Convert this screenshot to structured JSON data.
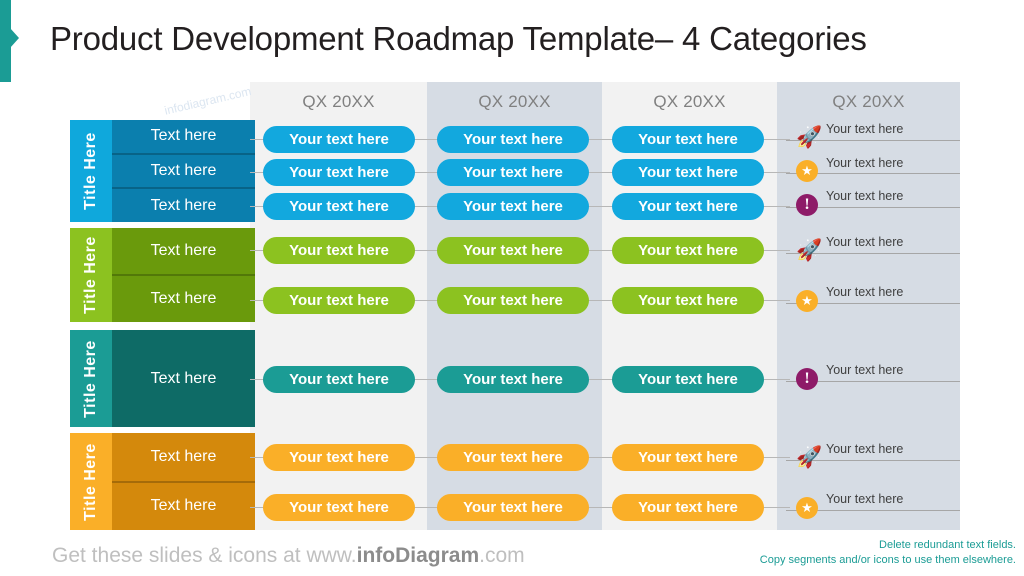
{
  "title": "Product Development Roadmap Template– 4 Categories",
  "columns": [
    {
      "label": "QX 20XX",
      "shade": "light"
    },
    {
      "label": "QX 20XX",
      "shade": "dark"
    },
    {
      "label": "QX 20XX",
      "shade": "light"
    },
    {
      "label": "QX 20XX",
      "shade": "dark"
    }
  ],
  "watermark": "infodiagram.com",
  "pill_label": "Your text here",
  "row_label": "Text here",
  "categories": [
    {
      "title": "Title Here",
      "title_color": "#0FA8DC",
      "panel_color": "#0B7FAE",
      "pill_color": "#12A8DE",
      "rows": [
        "Text here",
        "Text here",
        "Text here"
      ]
    },
    {
      "title": "Title Here",
      "title_color": "#8CC220",
      "panel_color": "#6A9A0C",
      "pill_color": "#8CC220",
      "rows": [
        "Text here",
        "Text here"
      ]
    },
    {
      "title": "Title Here",
      "title_color": "#1B9C95",
      "panel_color": "#0E6B66",
      "pill_color": "#1B9C95",
      "rows": [
        "Text here"
      ]
    },
    {
      "title": "Title Here",
      "title_color": "#FAAF28",
      "panel_color": "#D4890C",
      "pill_color": "#FAAF28",
      "rows": [
        "Text here",
        "Text here"
      ]
    }
  ],
  "right_column": {
    "items": [
      {
        "text": "Your text here",
        "icon": "rocket-icon",
        "icon_color": "#0B7FAE"
      },
      {
        "text": "Your text here",
        "icon": "star-badge-icon",
        "icon_color": "#FAAF28"
      },
      {
        "text": "Your text here",
        "icon": "exclamation-badge-icon",
        "icon_color": "#8E1B68"
      },
      {
        "text": "Your text here",
        "icon": "rocket-icon",
        "icon_color": "#6A9A0C"
      },
      {
        "text": "Your text here",
        "icon": "star-badge-icon",
        "icon_color": "#FAAF28"
      },
      {
        "text": "Your text here",
        "icon": "exclamation-badge-icon",
        "icon_color": "#8E1B68"
      },
      {
        "text": "Your text here",
        "icon": "rocket-icon",
        "icon_color": "#D4890C"
      },
      {
        "text": "Your text here",
        "icon": "star-badge-icon",
        "icon_color": "#FAAF28"
      }
    ]
  },
  "footer": {
    "lead": "Get these slides & icons at www.",
    "brand": "infoDiagram",
    "tld": ".com",
    "note_line1": "Delete redundant text fields.",
    "note_line2": "Copy segments and/or icons to use them elsewhere.",
    "note_color": "#1B9C95"
  }
}
